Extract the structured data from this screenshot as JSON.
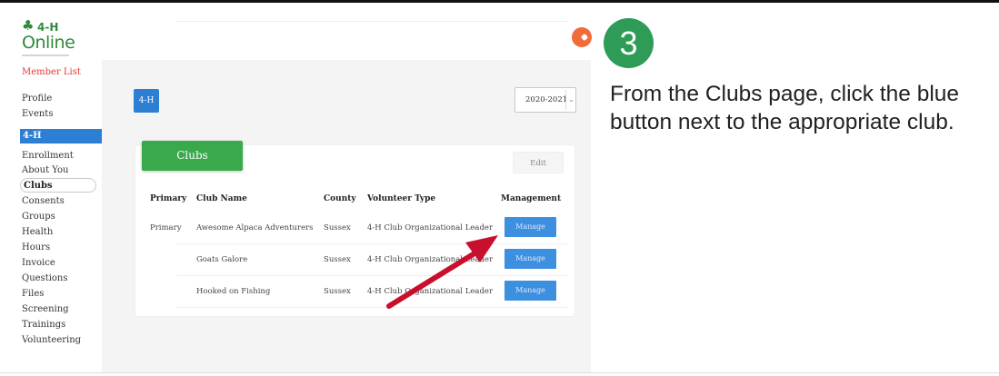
{
  "sidebar": {
    "logo_top": "4-H",
    "logo_bottom": "Online",
    "member_list": "Member List",
    "items": [
      {
        "label": "Profile"
      },
      {
        "label": "Events"
      },
      {
        "label": "4-H"
      },
      {
        "label": "Enrollment"
      },
      {
        "label": "About You"
      },
      {
        "label": "Clubs"
      },
      {
        "label": "Consents"
      },
      {
        "label": "Groups"
      },
      {
        "label": "Health"
      },
      {
        "label": "Hours"
      },
      {
        "label": "Invoice"
      },
      {
        "label": "Questions"
      },
      {
        "label": "Files"
      },
      {
        "label": "Screening"
      },
      {
        "label": "Trainings"
      },
      {
        "label": "Volunteering"
      }
    ]
  },
  "main": {
    "program_button": "4-H",
    "year": "2020-2021",
    "clubs_tab": "Clubs",
    "edit_button": "Edit",
    "table": {
      "headers": [
        "Primary",
        "Club Name",
        "County",
        "Volunteer Type",
        "Management"
      ],
      "rows": [
        {
          "primary": "Primary",
          "club": "Awesome Alpaca Adventurers",
          "county": "Sussex",
          "volunteer_type": "4-H Club Organizational Leader",
          "action": "Manage"
        },
        {
          "primary": "",
          "club": "Goats Galore",
          "county": "Sussex",
          "volunteer_type": "4-H Club Organizational Leader",
          "action": "Manage"
        },
        {
          "primary": "",
          "club": "Hooked on Fishing",
          "county": "Sussex",
          "volunteer_type": "4-H Club Organizational Leader",
          "action": "Manage"
        }
      ]
    }
  },
  "instruction": {
    "step_number": "3",
    "text": "From the Clubs page, click the blue button next to the appropriate club."
  },
  "colors": {
    "brand_green": "#2f8a3b",
    "accent_blue": "#2d7fd3",
    "clubs_green": "#3aa94b",
    "step_green": "#2e9c57",
    "arrow_red": "#c8102e"
  }
}
